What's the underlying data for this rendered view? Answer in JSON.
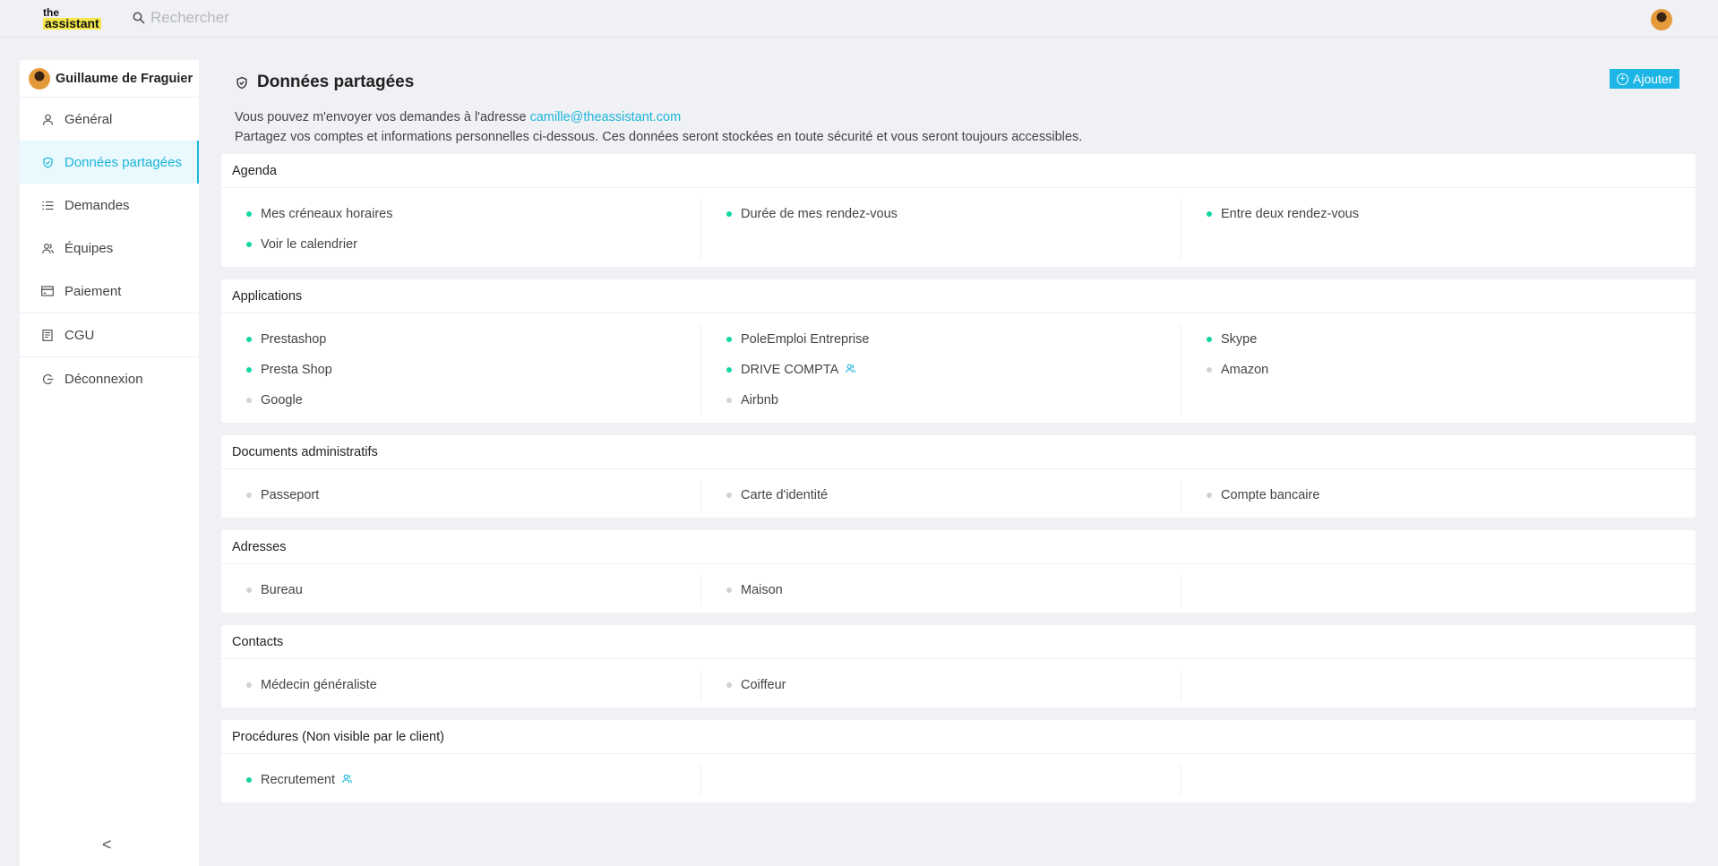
{
  "header": {
    "logo_line1": "the",
    "logo_line2": "assistant",
    "search_placeholder": "Rechercher"
  },
  "sidebar": {
    "user_name": "Guillaume de Fraguier",
    "items": [
      {
        "label": "Général",
        "icon": "user-icon",
        "active": false
      },
      {
        "label": "Données partagées",
        "icon": "shield-check-icon",
        "active": true
      },
      {
        "label": "Demandes",
        "icon": "list-icon",
        "active": false
      },
      {
        "label": "Équipes",
        "icon": "team-icon",
        "active": false
      },
      {
        "label": "Paiement",
        "icon": "card-icon",
        "active": false
      },
      {
        "label": "CGU",
        "icon": "document-icon",
        "active": false
      },
      {
        "label": "Déconnexion",
        "icon": "logout-icon",
        "active": false
      }
    ],
    "collapse_glyph": "<"
  },
  "page": {
    "title": "Données partagées",
    "add_label": "Ajouter",
    "desc_line1_prefix": "Vous pouvez m'envoyer vos demandes à l'adresse",
    "desc_email": "camille@theassistant.com",
    "desc_line2": "Partagez vos comptes et informations personnelles ci-dessous. Ces données seront stockées en toute sécurité et vous seront toujours accessibles."
  },
  "sections": [
    {
      "title": "Agenda",
      "columns": [
        [
          {
            "label": "Mes créneaux horaires",
            "active": true
          },
          {
            "label": "Voir le calendrier",
            "active": true
          }
        ],
        [
          {
            "label": "Durée de mes rendez-vous",
            "active": true
          }
        ],
        [
          {
            "label": "Entre deux rendez-vous",
            "active": true
          }
        ]
      ]
    },
    {
      "title": "Applications",
      "columns": [
        [
          {
            "label": "Prestashop",
            "active": true
          },
          {
            "label": "Presta Shop",
            "active": true
          },
          {
            "label": "Google",
            "active": false
          }
        ],
        [
          {
            "label": "PoleEmploi Entreprise",
            "active": true
          },
          {
            "label": "DRIVE COMPTA",
            "active": true,
            "team": true
          },
          {
            "label": "Airbnb",
            "active": false
          }
        ],
        [
          {
            "label": "Skype",
            "active": true
          },
          {
            "label": "Amazon",
            "active": false
          }
        ]
      ]
    },
    {
      "title": "Documents administratifs",
      "columns": [
        [
          {
            "label": "Passeport",
            "active": false
          }
        ],
        [
          {
            "label": "Carte d'identité",
            "active": false
          }
        ],
        [
          {
            "label": "Compte bancaire",
            "active": false
          }
        ]
      ]
    },
    {
      "title": "Adresses",
      "columns": [
        [
          {
            "label": "Bureau",
            "active": false
          }
        ],
        [
          {
            "label": "Maison",
            "active": false
          }
        ],
        []
      ]
    },
    {
      "title": "Contacts",
      "columns": [
        [
          {
            "label": "Médecin généraliste",
            "active": false
          }
        ],
        [
          {
            "label": "Coiffeur",
            "active": false
          }
        ],
        []
      ]
    },
    {
      "title": "Procédures (Non visible par le client)",
      "columns": [
        [
          {
            "label": "Recrutement",
            "active": true,
            "team": true
          }
        ],
        [],
        []
      ]
    }
  ],
  "colors": {
    "accent": "#1bb6d9",
    "status_active": "#12d6a0",
    "status_inactive": "#cfd2d8",
    "logo_highlight": "#f5e64a"
  }
}
